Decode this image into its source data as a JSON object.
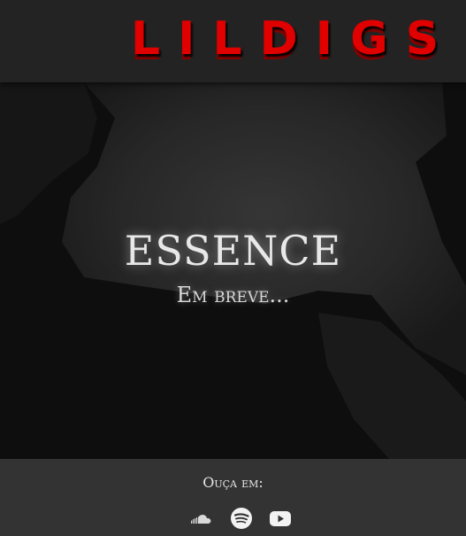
{
  "header": {
    "logo_text": "LILDIGS"
  },
  "hero": {
    "title": "ESSENCE",
    "subtitle": "Em breve..."
  },
  "footer": {
    "label": "Ouça em:",
    "links": [
      {
        "icon": "soundcloud-icon"
      },
      {
        "icon": "spotify-icon"
      },
      {
        "icon": "youtube-icon"
      }
    ]
  },
  "colors": {
    "logo_red": "#e00000",
    "header_bg": "#232323",
    "hero_bg": "#0f0f0f",
    "footer_bg": "#333333",
    "text_light": "#e8e8e8"
  }
}
